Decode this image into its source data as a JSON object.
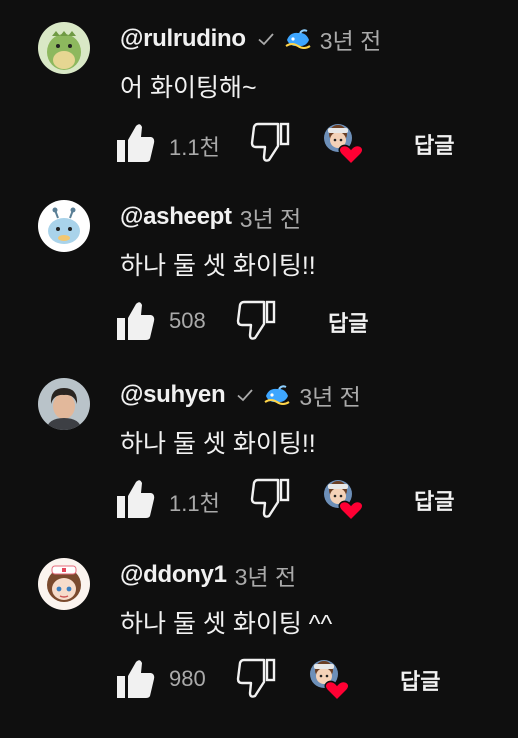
{
  "comments": [
    {
      "author": "@rulrudino",
      "verified": true,
      "member_badge": true,
      "time": "3년 전",
      "text": "어 화이팅해~",
      "likes": "1.1천",
      "creator_heart": true,
      "reply_label": "답글",
      "avatar_icon": "green-dino-avatar"
    },
    {
      "author": "@asheept",
      "verified": false,
      "member_badge": false,
      "time": "3년 전",
      "text": "하나 둘 셋 화이팅!!",
      "likes": "508",
      "creator_heart": false,
      "reply_label": "답글",
      "avatar_icon": "blue-bee-avatar"
    },
    {
      "author": "@suhyen",
      "verified": true,
      "member_badge": true,
      "time": "3년 전",
      "text": "하나 둘 셋 화이팅!!",
      "likes": "1.1천",
      "creator_heart": true,
      "reply_label": "답글",
      "avatar_icon": "person-photo-avatar"
    },
    {
      "author": "@ddony1",
      "verified": false,
      "member_badge": false,
      "time": "3년 전",
      "text": "하나 둘 셋 화이팅 ^^",
      "likes": "980",
      "creator_heart": true,
      "reply_label": "답글",
      "avatar_icon": "nurse-girl-avatar"
    }
  ],
  "colors": {
    "background": "#0f0f0f",
    "text_primary": "#f1f1f1",
    "text_secondary": "#aaaaaa",
    "heart": "#ff0033",
    "badge_blue": "#3ea6ff"
  }
}
